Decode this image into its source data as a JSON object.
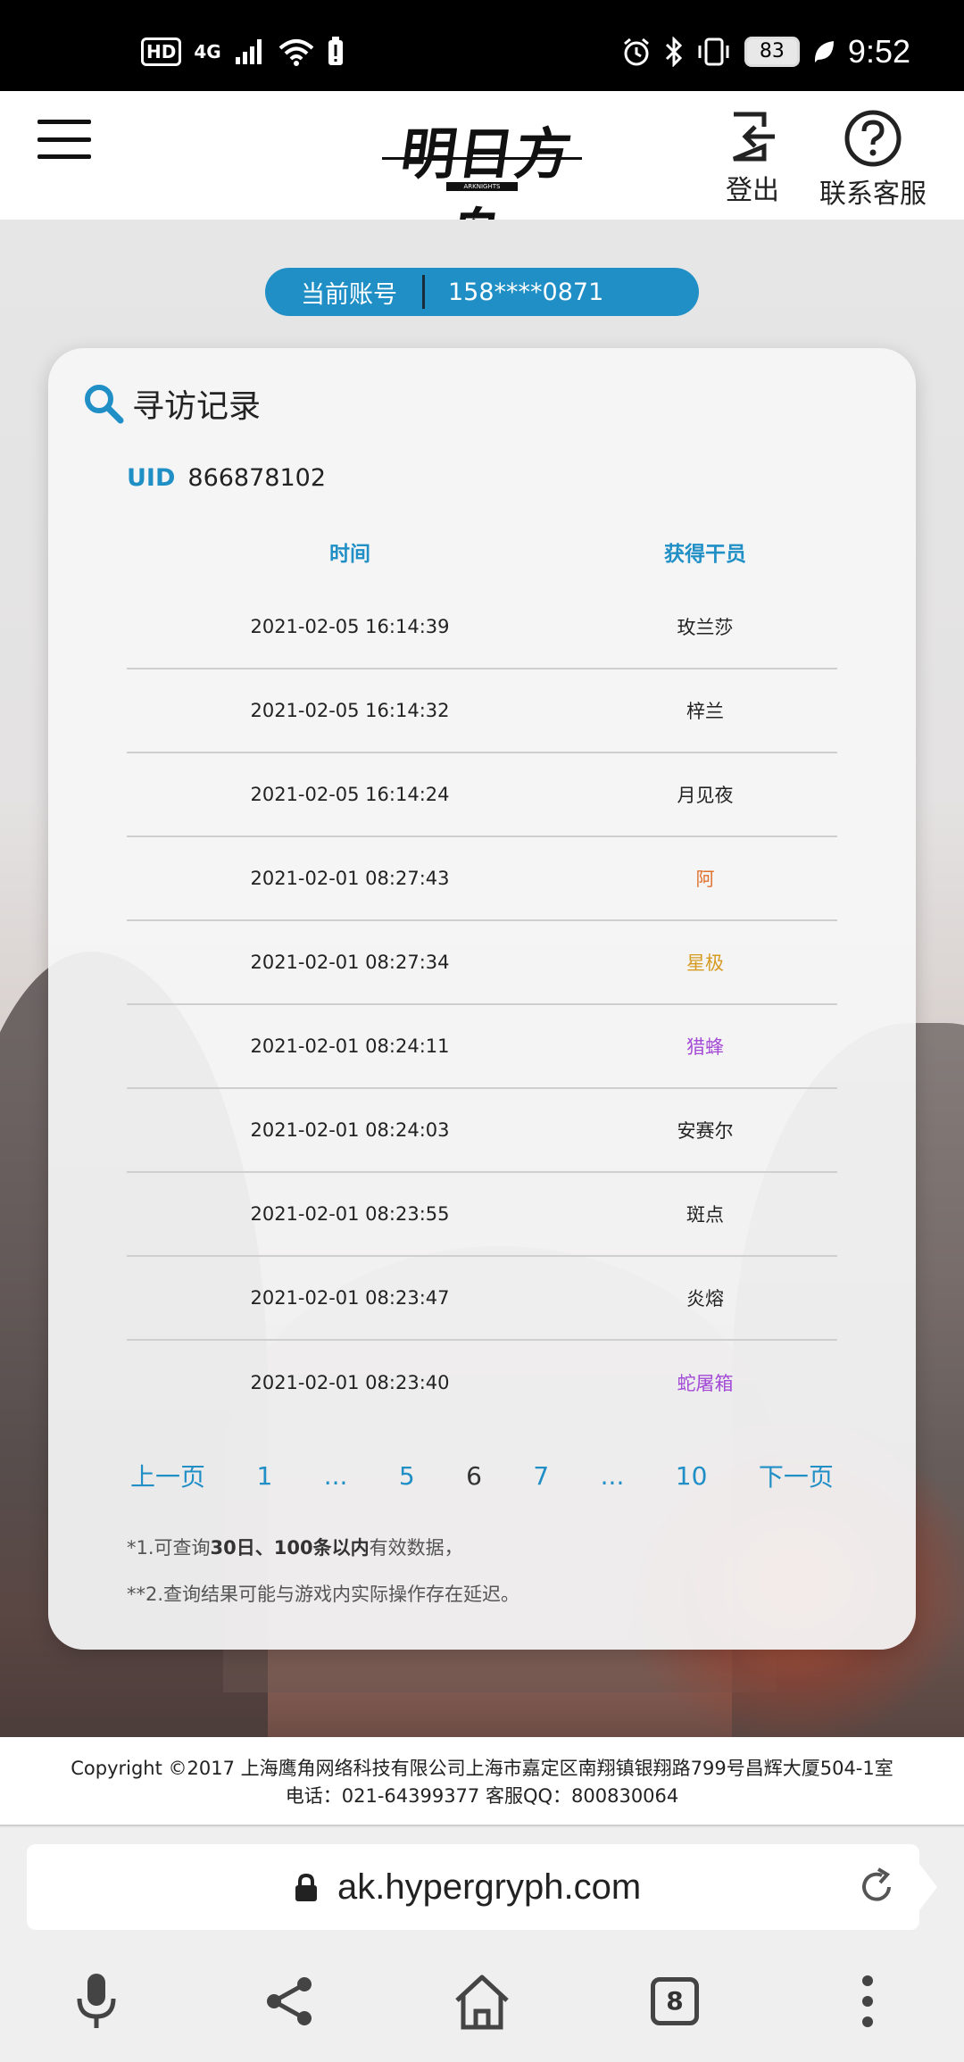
{
  "status_bar": {
    "hd": "HD",
    "network": "4G",
    "battery": "83",
    "time": "9:52"
  },
  "header": {
    "logo_text": "明日方舟",
    "logo_sub": "ARKNIGHTS",
    "logout_label": "登出",
    "support_label": "联系客服"
  },
  "account": {
    "label": "当前账号",
    "value": "158****0871"
  },
  "card": {
    "title": "寻访记录",
    "uid_label": "UID",
    "uid_value": "866878102",
    "columns": [
      "时间",
      "获得干员"
    ],
    "rows": [
      {
        "time": "2021-02-05 16:14:39",
        "operator": "玫兰莎",
        "color": "#222222"
      },
      {
        "time": "2021-02-05 16:14:32",
        "operator": "梓兰",
        "color": "#222222"
      },
      {
        "time": "2021-02-05 16:14:24",
        "operator": "月见夜",
        "color": "#222222"
      },
      {
        "time": "2021-02-01 08:27:43",
        "operator": "阿",
        "color": "#e0702e"
      },
      {
        "time": "2021-02-01 08:27:34",
        "operator": "星极",
        "color": "#d69b23"
      },
      {
        "time": "2021-02-01 08:24:11",
        "operator": "猎蜂",
        "color": "#a34ad6"
      },
      {
        "time": "2021-02-01 08:24:03",
        "operator": "安赛尔",
        "color": "#222222"
      },
      {
        "time": "2021-02-01 08:23:55",
        "operator": "斑点",
        "color": "#222222"
      },
      {
        "time": "2021-02-01 08:23:47",
        "operator": "炎熔",
        "color": "#222222"
      },
      {
        "time": "2021-02-01 08:23:40",
        "operator": "蛇屠箱",
        "color": "#a34ad6"
      }
    ],
    "pager": {
      "prev": "上一页",
      "items": [
        "1",
        "...",
        "5",
        "6",
        "7",
        "...",
        "10"
      ],
      "current": "6",
      "next": "下一页"
    },
    "notes": {
      "note1_prefix": "*1.可查询",
      "note1_bold1": "30日",
      "note1_sep": "、",
      "note1_bold2": "100条以内",
      "note1_suffix": "有效数据，",
      "note2": "**2.查询结果可能与游戏内实际操作存在延迟。"
    }
  },
  "footer": {
    "line1": "Copyright ©2017 上海鹰角网络科技有限公司上海市嘉定区南翔镇银翔路799号昌辉大厦504-1室",
    "line2": "电话：021-64399377 客服QQ：800830064"
  },
  "browser": {
    "url": "ak.hypergryph.com",
    "tab_count": "8"
  },
  "colors": {
    "accent": "#1f8fc6",
    "rarity_orange": "#e0702e",
    "rarity_gold": "#d69b23",
    "rarity_purple": "#a34ad6"
  }
}
